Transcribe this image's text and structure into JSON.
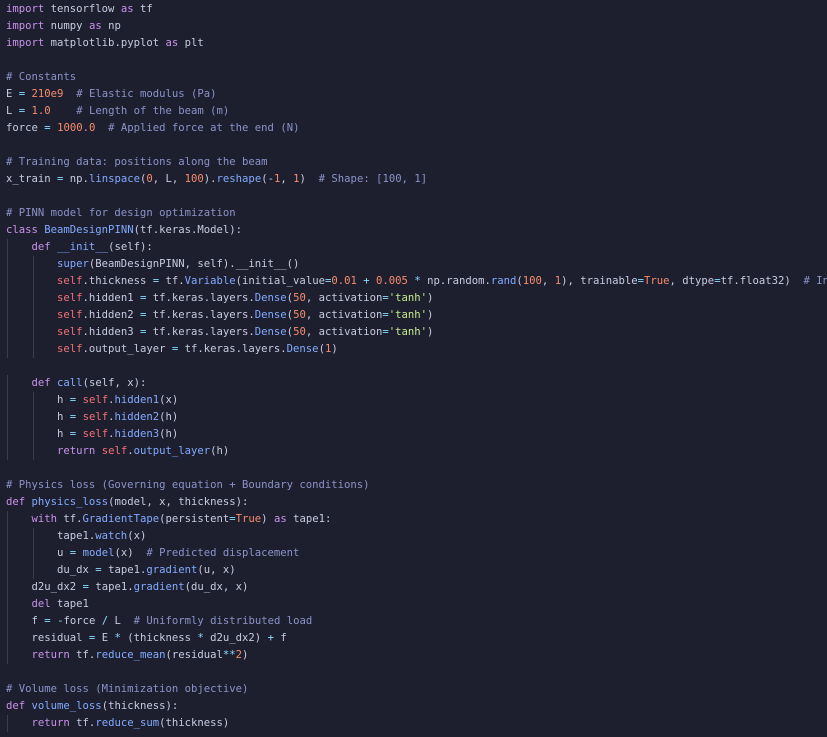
{
  "colors": {
    "background": "#1e1f2e",
    "keyword": "#c792ea",
    "function": "#82aaff",
    "number": "#f78c6c",
    "string": "#c3e88d",
    "comment": "#8a93c8",
    "operator": "#89ddff",
    "self": "#f07178",
    "text": "#c6cbe0",
    "indent_guide": "#3a3c52"
  },
  "code": {
    "lines": [
      [
        [
          "kw",
          "import"
        ],
        [
          "txt",
          " tensorflow "
        ],
        [
          "kw",
          "as"
        ],
        [
          "txt",
          " tf"
        ]
      ],
      [
        [
          "kw",
          "import"
        ],
        [
          "txt",
          " numpy "
        ],
        [
          "kw",
          "as"
        ],
        [
          "txt",
          " np"
        ]
      ],
      [
        [
          "kw",
          "import"
        ],
        [
          "txt",
          " matplotlib.pyplot "
        ],
        [
          "kw",
          "as"
        ],
        [
          "txt",
          " plt"
        ]
      ],
      [],
      [
        [
          "cm",
          "# Constants"
        ]
      ],
      [
        [
          "txt",
          "E "
        ],
        [
          "op",
          "="
        ],
        [
          "txt",
          " "
        ],
        [
          "num",
          "210e9"
        ],
        [
          "txt",
          "  "
        ],
        [
          "cm",
          "# Elastic modulus (Pa)"
        ]
      ],
      [
        [
          "txt",
          "L "
        ],
        [
          "op",
          "="
        ],
        [
          "txt",
          " "
        ],
        [
          "num",
          "1.0"
        ],
        [
          "txt",
          "    "
        ],
        [
          "cm",
          "# Length of the beam (m)"
        ]
      ],
      [
        [
          "txt",
          "force "
        ],
        [
          "op",
          "="
        ],
        [
          "txt",
          " "
        ],
        [
          "num",
          "1000.0"
        ],
        [
          "txt",
          "  "
        ],
        [
          "cm",
          "# Applied force at the end (N)"
        ]
      ],
      [],
      [
        [
          "cm",
          "# Training data: positions along the beam"
        ]
      ],
      [
        [
          "txt",
          "x_train "
        ],
        [
          "op",
          "="
        ],
        [
          "txt",
          " np."
        ],
        [
          "fn",
          "linspace"
        ],
        [
          "txt",
          "("
        ],
        [
          "num",
          "0"
        ],
        [
          "txt",
          ", L, "
        ],
        [
          "num",
          "100"
        ],
        [
          "txt",
          ")."
        ],
        [
          "fn",
          "reshape"
        ],
        [
          "txt",
          "("
        ],
        [
          "op",
          "-"
        ],
        [
          "num",
          "1"
        ],
        [
          "txt",
          ", "
        ],
        [
          "num",
          "1"
        ],
        [
          "txt",
          ")  "
        ],
        [
          "cm",
          "# Shape: [100, 1]"
        ]
      ],
      [],
      [
        [
          "cm",
          "# PINN model for design optimization"
        ]
      ],
      [
        [
          "kw",
          "class"
        ],
        [
          "txt",
          " "
        ],
        [
          "fn",
          "BeamDesignPINN"
        ],
        [
          "txt",
          "(tf.keras.Model):"
        ]
      ],
      [
        [
          "txt",
          "    "
        ],
        [
          "kw",
          "def"
        ],
        [
          "txt",
          " "
        ],
        [
          "fn",
          "__init__"
        ],
        [
          "txt",
          "(self):"
        ]
      ],
      [
        [
          "txt",
          "        "
        ],
        [
          "fn",
          "super"
        ],
        [
          "txt",
          "(BeamDesignPINN, self).__init__()"
        ]
      ],
      [
        [
          "txt",
          "        "
        ],
        [
          "self",
          "self"
        ],
        [
          "txt",
          ".thickness "
        ],
        [
          "op",
          "="
        ],
        [
          "txt",
          " tf."
        ],
        [
          "fn",
          "Variable"
        ],
        [
          "txt",
          "(initial_value"
        ],
        [
          "op",
          "="
        ],
        [
          "num",
          "0.01"
        ],
        [
          "txt",
          " "
        ],
        [
          "op",
          "+"
        ],
        [
          "txt",
          " "
        ],
        [
          "num",
          "0.005"
        ],
        [
          "txt",
          " "
        ],
        [
          "op",
          "*"
        ],
        [
          "txt",
          " np.random."
        ],
        [
          "fn",
          "rand"
        ],
        [
          "txt",
          "("
        ],
        [
          "num",
          "100"
        ],
        [
          "txt",
          ", "
        ],
        [
          "num",
          "1"
        ],
        [
          "txt",
          "), trainable"
        ],
        [
          "op",
          "="
        ],
        [
          "num",
          "True"
        ],
        [
          "txt",
          ", dtype"
        ],
        [
          "op",
          "="
        ],
        [
          "txt",
          "tf.float32)  "
        ],
        [
          "cm",
          "# Initial thickness"
        ]
      ],
      [
        [
          "txt",
          "        "
        ],
        [
          "self",
          "self"
        ],
        [
          "txt",
          ".hidden1 "
        ],
        [
          "op",
          "="
        ],
        [
          "txt",
          " tf.keras.layers."
        ],
        [
          "fn",
          "Dense"
        ],
        [
          "txt",
          "("
        ],
        [
          "num",
          "50"
        ],
        [
          "txt",
          ", activation"
        ],
        [
          "op",
          "="
        ],
        [
          "str",
          "'tanh'"
        ],
        [
          "txt",
          ")"
        ]
      ],
      [
        [
          "txt",
          "        "
        ],
        [
          "self",
          "self"
        ],
        [
          "txt",
          ".hidden2 "
        ],
        [
          "op",
          "="
        ],
        [
          "txt",
          " tf.keras.layers."
        ],
        [
          "fn",
          "Dense"
        ],
        [
          "txt",
          "("
        ],
        [
          "num",
          "50"
        ],
        [
          "txt",
          ", activation"
        ],
        [
          "op",
          "="
        ],
        [
          "str",
          "'tanh'"
        ],
        [
          "txt",
          ")"
        ]
      ],
      [
        [
          "txt",
          "        "
        ],
        [
          "self",
          "self"
        ],
        [
          "txt",
          ".hidden3 "
        ],
        [
          "op",
          "="
        ],
        [
          "txt",
          " tf.keras.layers."
        ],
        [
          "fn",
          "Dense"
        ],
        [
          "txt",
          "("
        ],
        [
          "num",
          "50"
        ],
        [
          "txt",
          ", activation"
        ],
        [
          "op",
          "="
        ],
        [
          "str",
          "'tanh'"
        ],
        [
          "txt",
          ")"
        ]
      ],
      [
        [
          "txt",
          "        "
        ],
        [
          "self",
          "self"
        ],
        [
          "txt",
          ".output_layer "
        ],
        [
          "op",
          "="
        ],
        [
          "txt",
          " tf.keras.layers."
        ],
        [
          "fn",
          "Dense"
        ],
        [
          "txt",
          "("
        ],
        [
          "num",
          "1"
        ],
        [
          "txt",
          ")"
        ]
      ],
      [],
      [
        [
          "txt",
          "    "
        ],
        [
          "kw",
          "def"
        ],
        [
          "txt",
          " "
        ],
        [
          "fn",
          "call"
        ],
        [
          "txt",
          "(self, x):"
        ]
      ],
      [
        [
          "txt",
          "        h "
        ],
        [
          "op",
          "="
        ],
        [
          "txt",
          " "
        ],
        [
          "self",
          "self"
        ],
        [
          "txt",
          "."
        ],
        [
          "fn",
          "hidden1"
        ],
        [
          "txt",
          "(x)"
        ]
      ],
      [
        [
          "txt",
          "        h "
        ],
        [
          "op",
          "="
        ],
        [
          "txt",
          " "
        ],
        [
          "self",
          "self"
        ],
        [
          "txt",
          "."
        ],
        [
          "fn",
          "hidden2"
        ],
        [
          "txt",
          "(h)"
        ]
      ],
      [
        [
          "txt",
          "        h "
        ],
        [
          "op",
          "="
        ],
        [
          "txt",
          " "
        ],
        [
          "self",
          "self"
        ],
        [
          "txt",
          "."
        ],
        [
          "fn",
          "hidden3"
        ],
        [
          "txt",
          "(h)"
        ]
      ],
      [
        [
          "txt",
          "        "
        ],
        [
          "kw",
          "return"
        ],
        [
          "txt",
          " "
        ],
        [
          "self",
          "self"
        ],
        [
          "txt",
          "."
        ],
        [
          "fn",
          "output_layer"
        ],
        [
          "txt",
          "(h)"
        ]
      ],
      [],
      [
        [
          "cm",
          "# Physics loss (Governing equation + Boundary conditions)"
        ]
      ],
      [
        [
          "kw",
          "def"
        ],
        [
          "txt",
          " "
        ],
        [
          "fn",
          "physics_loss"
        ],
        [
          "txt",
          "(model, x, thickness):"
        ]
      ],
      [
        [
          "txt",
          "    "
        ],
        [
          "kw",
          "with"
        ],
        [
          "txt",
          " tf."
        ],
        [
          "fn",
          "GradientTape"
        ],
        [
          "txt",
          "(persistent"
        ],
        [
          "op",
          "="
        ],
        [
          "num",
          "True"
        ],
        [
          "txt",
          ") "
        ],
        [
          "kw",
          "as"
        ],
        [
          "txt",
          " tape1:"
        ]
      ],
      [
        [
          "txt",
          "        tape1."
        ],
        [
          "fn",
          "watch"
        ],
        [
          "txt",
          "(x)"
        ]
      ],
      [
        [
          "txt",
          "        u "
        ],
        [
          "op",
          "="
        ],
        [
          "txt",
          " "
        ],
        [
          "fn",
          "model"
        ],
        [
          "txt",
          "(x)  "
        ],
        [
          "cm",
          "# Predicted displacement"
        ]
      ],
      [
        [
          "txt",
          "        du_dx "
        ],
        [
          "op",
          "="
        ],
        [
          "txt",
          " tape1."
        ],
        [
          "fn",
          "gradient"
        ],
        [
          "txt",
          "(u, x)"
        ]
      ],
      [
        [
          "txt",
          "    d2u_dx2 "
        ],
        [
          "op",
          "="
        ],
        [
          "txt",
          " tape1."
        ],
        [
          "fn",
          "gradient"
        ],
        [
          "txt",
          "(du_dx, x)"
        ]
      ],
      [
        [
          "txt",
          "    "
        ],
        [
          "kw",
          "del"
        ],
        [
          "txt",
          " tape1"
        ]
      ],
      [
        [
          "txt",
          "    f "
        ],
        [
          "op",
          "="
        ],
        [
          "txt",
          " "
        ],
        [
          "op",
          "-"
        ],
        [
          "txt",
          "force "
        ],
        [
          "op",
          "/"
        ],
        [
          "txt",
          " L  "
        ],
        [
          "cm",
          "# Uniformly distributed load"
        ]
      ],
      [
        [
          "txt",
          "    residual "
        ],
        [
          "op",
          "="
        ],
        [
          "txt",
          " E "
        ],
        [
          "op",
          "*"
        ],
        [
          "txt",
          " (thickness "
        ],
        [
          "op",
          "*"
        ],
        [
          "txt",
          " d2u_dx2) "
        ],
        [
          "op",
          "+"
        ],
        [
          "txt",
          " f"
        ]
      ],
      [
        [
          "txt",
          "    "
        ],
        [
          "kw",
          "return"
        ],
        [
          "txt",
          " tf."
        ],
        [
          "fn",
          "reduce_mean"
        ],
        [
          "txt",
          "(residual"
        ],
        [
          "op",
          "**"
        ],
        [
          "num",
          "2"
        ],
        [
          "txt",
          ")"
        ]
      ],
      [],
      [
        [
          "cm",
          "# Volume loss (Minimization objective)"
        ]
      ],
      [
        [
          "kw",
          "def"
        ],
        [
          "txt",
          " "
        ],
        [
          "fn",
          "volume_loss"
        ],
        [
          "txt",
          "(thickness):"
        ]
      ],
      [
        [
          "txt",
          "    "
        ],
        [
          "kw",
          "return"
        ],
        [
          "txt",
          " tf."
        ],
        [
          "fn",
          "reduce_sum"
        ],
        [
          "txt",
          "(thickness)"
        ]
      ]
    ]
  }
}
